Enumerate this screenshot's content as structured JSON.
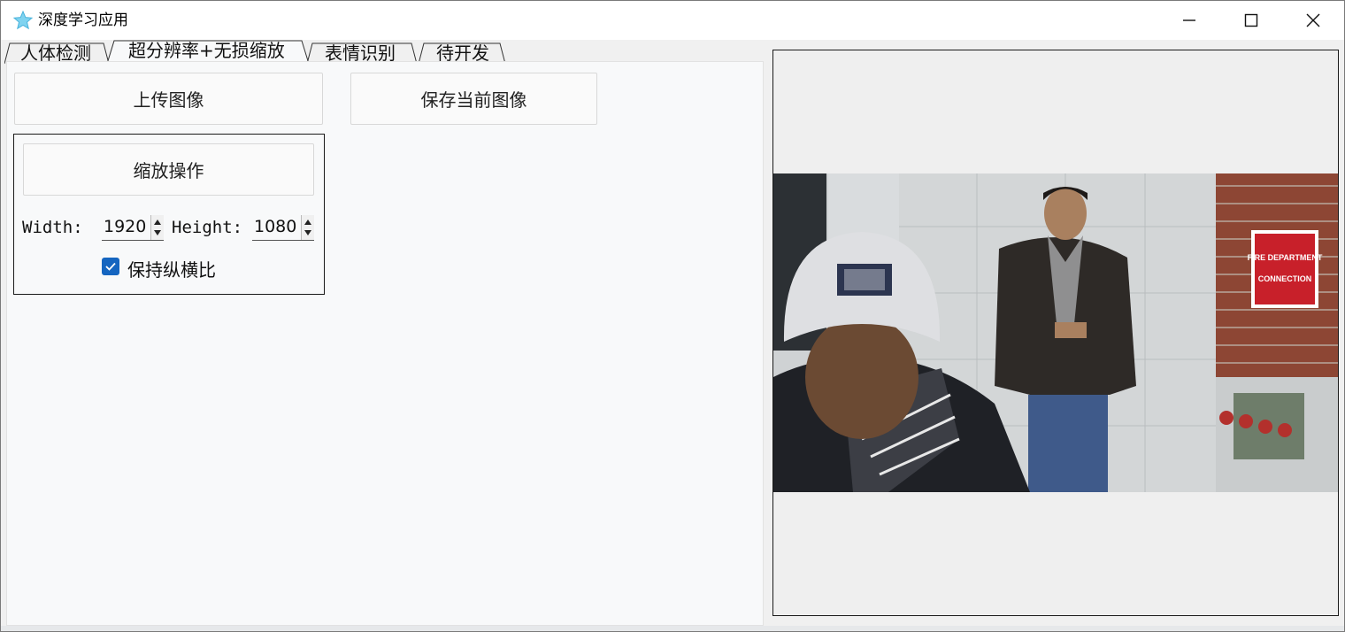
{
  "window": {
    "title": "深度学习应用",
    "icon": "star-app-icon",
    "controls": [
      "minimize-icon",
      "maximize-icon",
      "close-icon"
    ]
  },
  "tabs": [
    {
      "label": "人体检测",
      "active": false
    },
    {
      "label": "超分辨率+无损缩放",
      "active": true
    },
    {
      "label": "表情识别",
      "active": false
    },
    {
      "label": "待开发",
      "active": false
    }
  ],
  "buttons": {
    "upload": "上传图像",
    "save": "保存当前图像",
    "zoom": "缩放操作"
  },
  "zoom": {
    "width_label": "Width:",
    "width_value": "1920",
    "height_label": "Height:",
    "height_value": "1080",
    "keep_ratio_label": "保持纵横比",
    "keep_ratio_checked": true
  },
  "image": {
    "sign_line1": "FIRE DEPARTMENT",
    "sign_line2": "CONNECTION"
  },
  "colors": {
    "accent": "#1565c0",
    "sign_red": "#c8202a"
  }
}
